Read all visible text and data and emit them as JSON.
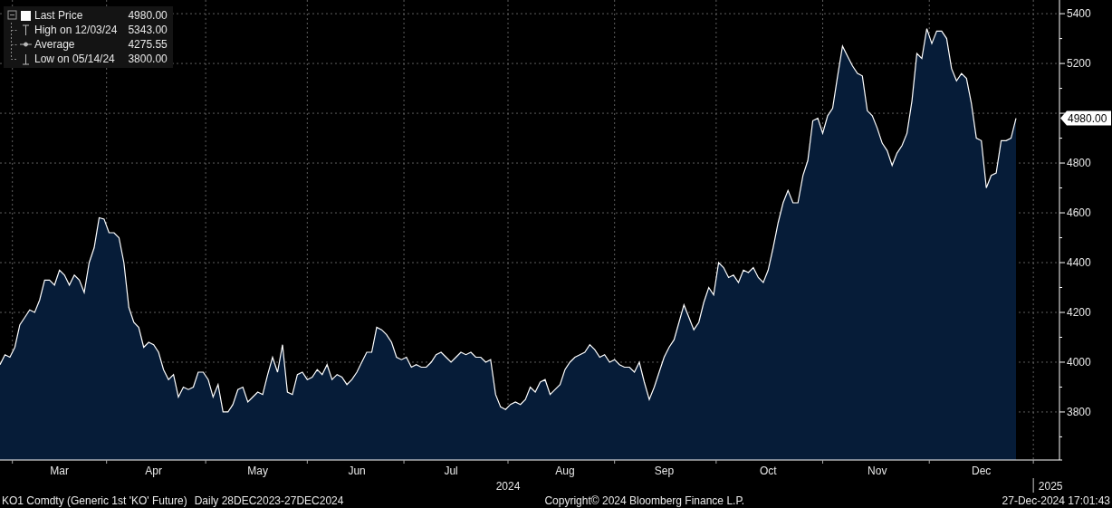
{
  "legend": [
    {
      "kind": "last",
      "value": "4980.00"
    },
    {
      "kind": "high",
      "label": "High on 12/03/24",
      "value": "5343.00"
    },
    {
      "kind": "average",
      "label": "Average",
      "value": "4275.55"
    },
    {
      "kind": "low",
      "label": "Low on 05/14/24",
      "value": "3800.00"
    }
  ],
  "chart_data": {
    "type": "area",
    "grid": true,
    "categories": [
      null,
      null,
      null,
      null,
      null,
      null,
      null,
      null,
      null,
      null,
      null,
      null,
      "Mar",
      null,
      null,
      null,
      null,
      null,
      null,
      null,
      null,
      null,
      null,
      null,
      null,
      null,
      null,
      null,
      null,
      null,
      null,
      "Apr",
      null,
      null,
      null,
      null,
      null,
      null,
      null,
      null,
      null,
      null,
      null,
      null,
      null,
      null,
      null,
      null,
      null,
      null,
      null,
      null,
      "May",
      null,
      null,
      null,
      null,
      null,
      null,
      null,
      null,
      null,
      null,
      null,
      null,
      null,
      null,
      null,
      null,
      null,
      null,
      null,
      "Jun",
      null,
      null,
      null,
      null,
      null,
      null,
      null,
      null,
      null,
      null,
      null,
      null,
      null,
      null,
      null,
      null,
      null,
      null,
      "Jul",
      null,
      null,
      null,
      null,
      null,
      null,
      null,
      null,
      null,
      null,
      null,
      null,
      null,
      null,
      null,
      null,
      null,
      null,
      null,
      null,
      null,
      null,
      "Aug",
      null,
      null,
      null,
      null,
      null,
      null,
      null,
      null,
      null,
      null,
      null,
      null,
      null,
      null,
      null,
      null,
      null,
      null,
      null,
      "Sep",
      null,
      null,
      null,
      null,
      null,
      null,
      null,
      null,
      null,
      null,
      null,
      null,
      null,
      null,
      null,
      null,
      null,
      null,
      null,
      null,
      "Oct",
      null,
      null,
      null,
      null,
      null,
      null,
      null,
      null,
      null,
      null,
      null,
      null,
      null,
      null,
      null,
      null,
      null,
      null,
      null,
      null,
      null,
      "Nov",
      null,
      null,
      null,
      null,
      null,
      null,
      null,
      null,
      null,
      null,
      null,
      null,
      null,
      null,
      null,
      null,
      null,
      null,
      null,
      null,
      "Dec",
      null,
      null,
      null,
      null,
      null,
      null,
      null
    ],
    "series": [
      {
        "name": "Last Price",
        "color": "#ffffff",
        "values": [
          3990,
          4030,
          4020,
          4060,
          4150,
          4180,
          4210,
          4200,
          4250,
          4330,
          4330,
          4310,
          4370,
          4350,
          4310,
          4350,
          4330,
          4280,
          4400,
          4460,
          4580,
          4575,
          4520,
          4520,
          4500,
          4400,
          4220,
          4160,
          4140,
          4060,
          4080,
          4070,
          4040,
          3970,
          3930,
          3950,
          3860,
          3900,
          3890,
          3900,
          3960,
          3960,
          3930,
          3860,
          3910,
          3800,
          3800,
          3830,
          3890,
          3900,
          3840,
          3860,
          3880,
          3870,
          3950,
          4020,
          3960,
          4070,
          3880,
          3870,
          3950,
          3960,
          3930,
          3940,
          3970,
          3950,
          3990,
          3930,
          3950,
          3940,
          3910,
          3930,
          3960,
          4000,
          4040,
          4040,
          4140,
          4130,
          4110,
          4080,
          4020,
          4010,
          4020,
          3980,
          3990,
          3980,
          3980,
          4000,
          4030,
          4040,
          4020,
          4000,
          4020,
          4040,
          4030,
          4040,
          4020,
          4020,
          4000,
          4010,
          3870,
          3820,
          3810,
          3830,
          3840,
          3830,
          3850,
          3900,
          3880,
          3920,
          3930,
          3870,
          3890,
          3910,
          3970,
          4000,
          4020,
          4030,
          4040,
          4070,
          4050,
          4020,
          4030,
          4000,
          4010,
          3990,
          3980,
          3980,
          3960,
          4000,
          3920,
          3850,
          3900,
          3960,
          4020,
          4060,
          4090,
          4160,
          4230,
          4180,
          4130,
          4160,
          4240,
          4300,
          4270,
          4400,
          4380,
          4340,
          4350,
          4320,
          4370,
          4360,
          4380,
          4340,
          4320,
          4370,
          4460,
          4560,
          4640,
          4690,
          4640,
          4640,
          4750,
          4810,
          4970,
          4980,
          4920,
          4990,
          5020,
          5150,
          5270,
          5230,
          5190,
          5160,
          5150,
          5010,
          4990,
          4940,
          4880,
          4850,
          4790,
          4840,
          4870,
          4920,
          5050,
          5240,
          5220,
          5340,
          5280,
          5330,
          5330,
          5300,
          5180,
          5130,
          5160,
          5140,
          5040,
          4900,
          4890,
          4700,
          4750,
          4760,
          4890,
          4890,
          4900,
          4980
        ]
      }
    ],
    "ylim": [
      3607,
      5455
    ],
    "yticks": [
      3800,
      4000,
      4200,
      4400,
      4600,
      4800,
      5200,
      5400
    ]
  },
  "year_labels": [
    "2024",
    "2025"
  ],
  "last_price_tag": "4980.00",
  "footer": {
    "security": "KO1 Comdty (Generic 1st 'KO' Future)",
    "range": "Daily 28DEC2023-27DEC2024",
    "copyright": "Copyright© 2024 Bloomberg Finance L.P.",
    "timestamp": "27-Dec-2024 17:01:43"
  }
}
